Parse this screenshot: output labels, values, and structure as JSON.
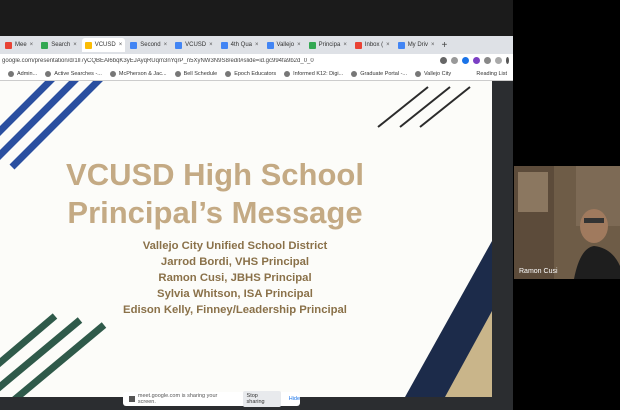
{
  "tabs": [
    {
      "label": "Mee",
      "color": "#e84335"
    },
    {
      "label": "Search",
      "color": "#34a853"
    },
    {
      "label": "VCUSD",
      "color": "#fbbc04",
      "active": true
    },
    {
      "label": "Second",
      "color": "#4285f4"
    },
    {
      "label": "VCUSD",
      "color": "#4285f4"
    },
    {
      "label": "4th Qua",
      "color": "#4285f4"
    },
    {
      "label": "Vallejo",
      "color": "#4285f4"
    },
    {
      "label": "Principa",
      "color": "#34a853"
    },
    {
      "label": "Inbox (",
      "color": "#ea4335"
    },
    {
      "label": "My Driv",
      "color": "#4285f4"
    }
  ],
  "address": {
    "url": "google.com/presentation/d/1lI7yCQBEAl6bqK3yEJAyqRUqm3nYqrP_n5XyNW3N9S8/edit#slide=id.gc994fa9b2d_0_0"
  },
  "bookmarks": [
    "Admin...",
    "Active Searches -...",
    "McPherson & Jac...",
    "Bell Schedule",
    "Epoch Educators",
    "Informed K12: Digi...",
    "Graduate Portal -...",
    "Vallejo City"
  ],
  "bookmarks_right": "Reading List",
  "slide": {
    "title_line1": "VCUSD High School",
    "title_line2": "Principal’s Message",
    "subtitle_lines": [
      "Vallejo City Unified School District",
      "Jarrod Bordi, VHS Principal",
      "Ramon Cusi, JBHS Principal",
      "Sylvia Whitson, ISA Principal",
      "Edison Kelly, Finney/Leadership Principal"
    ]
  },
  "share_bar": {
    "message": "meet.google.com is sharing your screen.",
    "stop": "Stop sharing",
    "hide": "Hide"
  },
  "participant": {
    "name": "Ramon Cusi"
  },
  "colors": {
    "title": "#c4aa84",
    "subtitle": "#8a7149",
    "blue_stripe": "#2a4fa0",
    "green_stripe": "#2f5a4a"
  }
}
